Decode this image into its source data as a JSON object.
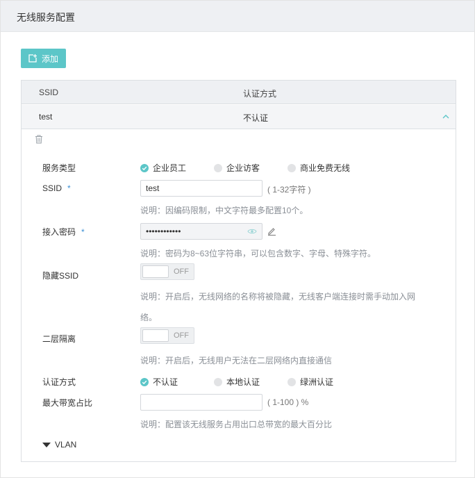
{
  "header": {
    "title": "无线服务配置"
  },
  "toolbar": {
    "add_label": "添加"
  },
  "table": {
    "columns": [
      "SSID",
      "认证方式"
    ],
    "rows": [
      {
        "ssid": "test",
        "auth": "不认证"
      }
    ]
  },
  "form": {
    "service_type": {
      "label": "服务类型",
      "options": [
        "企业员工",
        "企业访客",
        "商业免费无线"
      ],
      "selected": "企业员工"
    },
    "ssid": {
      "label": "SSID",
      "required_mark": "*",
      "value": "test",
      "hint": "( 1-32字符 )",
      "desc": "说明：因编码限制，中文字符最多配置10个。"
    },
    "password": {
      "label": "接入密码",
      "required_mark": "*",
      "value": "••••••••••••",
      "desc": "说明：密码为8~63位字符串，可以包含数字、字母、特殊字符。"
    },
    "hide_ssid": {
      "label": "隐藏SSID",
      "state": "OFF",
      "desc_line1": "说明：开启后，无线网络的名称将被隐藏，无线客户端连接时需手动加入网",
      "desc_line2": "络。"
    },
    "isolation": {
      "label": "二层隔离",
      "state": "OFF",
      "desc": "说明：开启后，无线用户无法在二层网络内直接通信"
    },
    "auth_method": {
      "label": "认证方式",
      "options": [
        "不认证",
        "本地认证",
        "绿洲认证"
      ],
      "selected": "不认证"
    },
    "bandwidth": {
      "label": "最大带宽占比",
      "value": "",
      "hint": "( 1-100 ) %",
      "desc": "说明：配置该无线服务占用出口总带宽的最大百分比"
    },
    "vlan": {
      "label": "VLAN"
    }
  },
  "colors": {
    "accent": "#5cc6c8",
    "header_bg": "#eef0f3",
    "required": "#3b8fd4"
  }
}
